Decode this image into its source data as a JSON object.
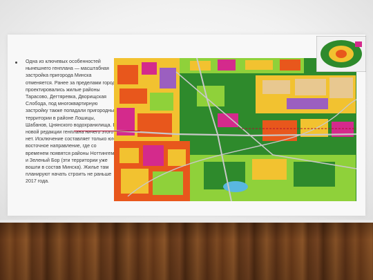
{
  "slide": {
    "bullet_text": "Одна из ключевых особенностей нынешнего генплана — масштабная застройка пригорода Минска отменяется. Ранее за пределами города проектировались жилые районы Тарасово, Дегтяревка, Дворищская Слобода, под многоквартирную застройку также попадали пригородные территории в районе Лошицы, Шабанов, Цнянского водохранилища. В новой редакции генплана ничего этого нет. Исключение составляет только юго-восточное направление, где со временем появятся районы Ноттингем и Зеленый Бор (эти территории уже вошли в состав Минска). Жилье там планируют начать строить не раньше 2017 года."
  },
  "colors": {
    "residential_dense": "#e8571c",
    "residential_low": "#f2c230",
    "green_space": "#2e8a2c",
    "light_green": "#8fd13a",
    "public_zone": "#d42a8c",
    "industrial": "#9b5fc0",
    "road": "#c8c8c8",
    "water": "#59b7e0",
    "pointer": "#b01030"
  }
}
